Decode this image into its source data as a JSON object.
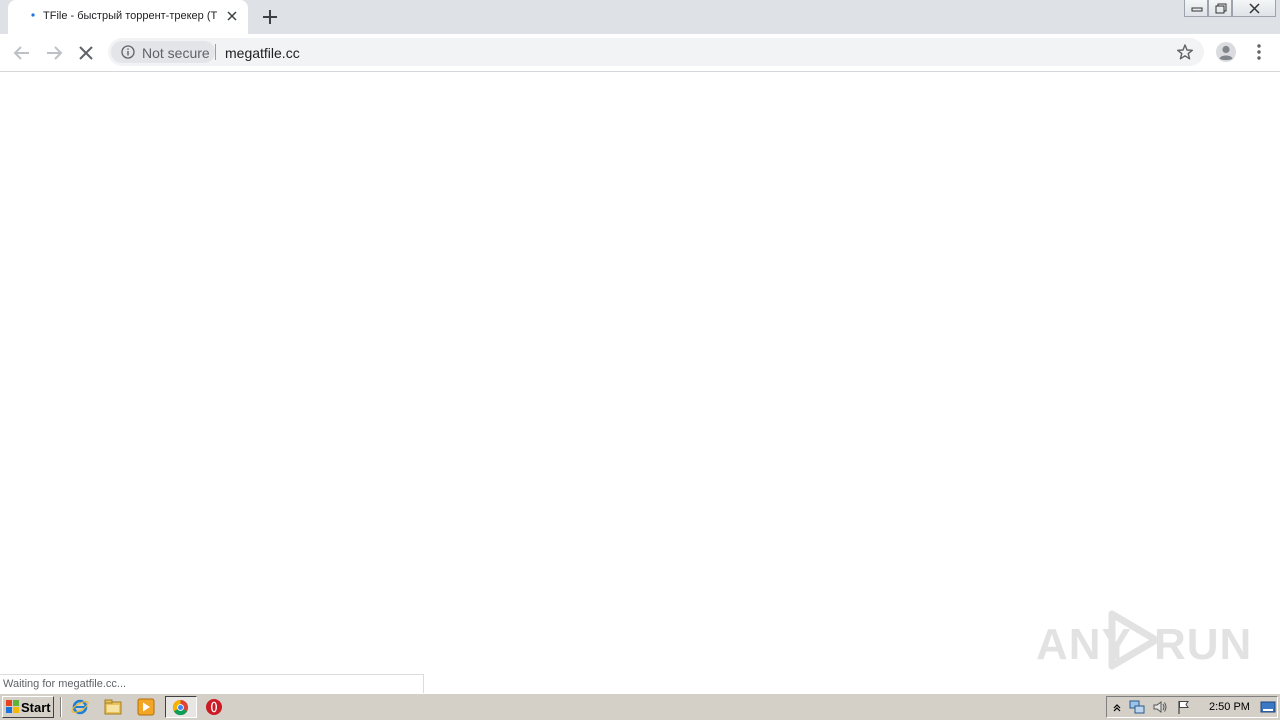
{
  "browser": {
    "tab": {
      "title": "TFile - быстрый торрент-трекер (Т"
    },
    "omnibox": {
      "security_label": "Not secure",
      "url": "megatfile.cc"
    },
    "status_text": "Waiting for megatfile.cc..."
  },
  "watermark": {
    "left": "ANY",
    "right": "RUN"
  },
  "taskbar": {
    "start_label": "Start",
    "clock": "2:50 PM"
  }
}
